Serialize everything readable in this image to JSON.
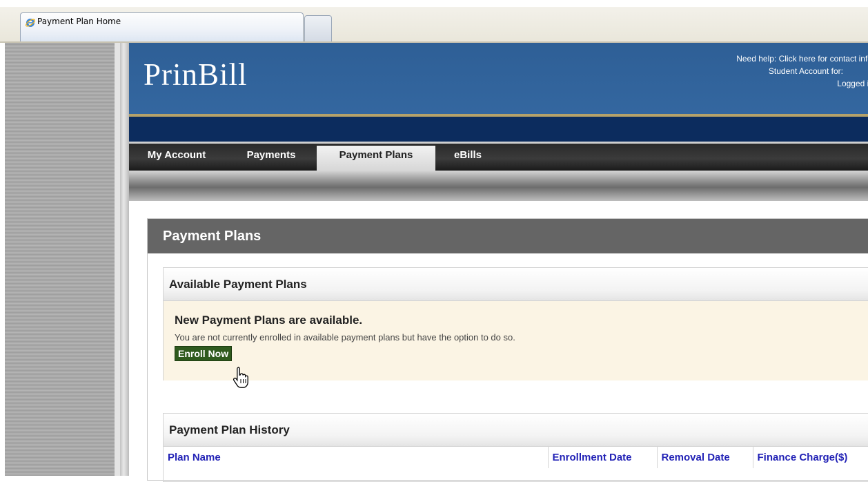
{
  "browser": {
    "tab_title": "Payment Plan Home"
  },
  "header": {
    "logo": "PrinBill",
    "help_link": "Need help: Click here for contact info",
    "account_label": "Student Account for:",
    "logged_in_label": "Logged in"
  },
  "nav": {
    "items": [
      {
        "label": "My Account"
      },
      {
        "label": "Payments"
      },
      {
        "label": "Payment Plans"
      },
      {
        "label": "eBills"
      }
    ],
    "active": "Payment Plans"
  },
  "main": {
    "title": "Payment Plans",
    "available": {
      "heading": "Available Payment Plans",
      "notice_title": "New Payment Plans are available.",
      "notice_text": "You are not currently enrolled in available payment plans but have the option to do so.",
      "enroll_button": "Enroll Now"
    },
    "history": {
      "heading": "Payment Plan History",
      "columns": [
        "Plan Name",
        "Enrollment Date",
        "Removal Date",
        "Finance Charge($)"
      ]
    }
  },
  "colors": {
    "header_blue": "#3467a0",
    "gold_accent": "#b6a26a",
    "navy_band": "#0c2c5e",
    "enroll_green": "#2f5a1e",
    "notice_bg": "#fbf4e4",
    "column_header_blue": "#2222b6"
  }
}
